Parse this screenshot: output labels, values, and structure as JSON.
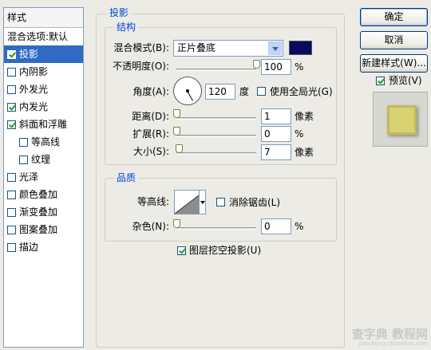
{
  "styles_panel": {
    "header": "样式",
    "items": [
      {
        "label": "混合选项:默认",
        "checkbox": false,
        "checked": false,
        "selected": false,
        "indent": false
      },
      {
        "label": "投影",
        "checkbox": true,
        "checked": true,
        "selected": true,
        "indent": false
      },
      {
        "label": "内阴影",
        "checkbox": true,
        "checked": false,
        "selected": false,
        "indent": false
      },
      {
        "label": "外发光",
        "checkbox": true,
        "checked": false,
        "selected": false,
        "indent": false
      },
      {
        "label": "内发光",
        "checkbox": true,
        "checked": true,
        "selected": false,
        "indent": false
      },
      {
        "label": "斜面和浮雕",
        "checkbox": true,
        "checked": true,
        "selected": false,
        "indent": false
      },
      {
        "label": "等高线",
        "checkbox": true,
        "checked": false,
        "selected": false,
        "indent": true
      },
      {
        "label": "纹理",
        "checkbox": true,
        "checked": false,
        "selected": false,
        "indent": true
      },
      {
        "label": "光泽",
        "checkbox": true,
        "checked": false,
        "selected": false,
        "indent": false
      },
      {
        "label": "颜色叠加",
        "checkbox": true,
        "checked": false,
        "selected": false,
        "indent": false
      },
      {
        "label": "渐变叠加",
        "checkbox": true,
        "checked": false,
        "selected": false,
        "indent": false
      },
      {
        "label": "图案叠加",
        "checkbox": true,
        "checked": false,
        "selected": false,
        "indent": false
      },
      {
        "label": "描边",
        "checkbox": true,
        "checked": false,
        "selected": false,
        "indent": false
      }
    ]
  },
  "drop_shadow": {
    "title": "投影",
    "structure": {
      "title": "结构",
      "blend_mode_label": "混合模式(B):",
      "blend_mode_value": "正片叠底",
      "shadow_color": "#0a0a5c",
      "opacity_label": "不透明度(O):",
      "opacity_value": "100",
      "opacity_level": 1.0,
      "opacity_unit": "%",
      "angle_label": "角度(A):",
      "angle_value": "120",
      "angle_unit": "度",
      "global_light_label": "使用全局光(G)",
      "global_light_checked": false,
      "distance_label": "距离(D):",
      "distance_value": "1",
      "distance_level": 0.0,
      "distance_unit": "像素",
      "spread_label": "扩展(R):",
      "spread_value": "0",
      "spread_level": 0.0,
      "spread_unit": "%",
      "size_label": "大小(S):",
      "size_value": "7",
      "size_level": 0.03,
      "size_unit": "像素"
    },
    "quality": {
      "title": "品质",
      "contour_label": "等高线:",
      "anti_alias_label": "消除锯齿(L)",
      "anti_alias_checked": false,
      "noise_label": "杂色(N):",
      "noise_value": "0",
      "noise_level": 0.0,
      "noise_unit": "%"
    },
    "knockout_label": "图层挖空投影(U)",
    "knockout_checked": true
  },
  "buttons": {
    "ok": "确定",
    "cancel": "取消",
    "new_style": "新建样式(W)...",
    "preview_label": "预览(V)",
    "preview_checked": true
  },
  "watermark": {
    "line1": "查字典 教程网",
    "line2": "jiaocheng.chazidian.com"
  }
}
